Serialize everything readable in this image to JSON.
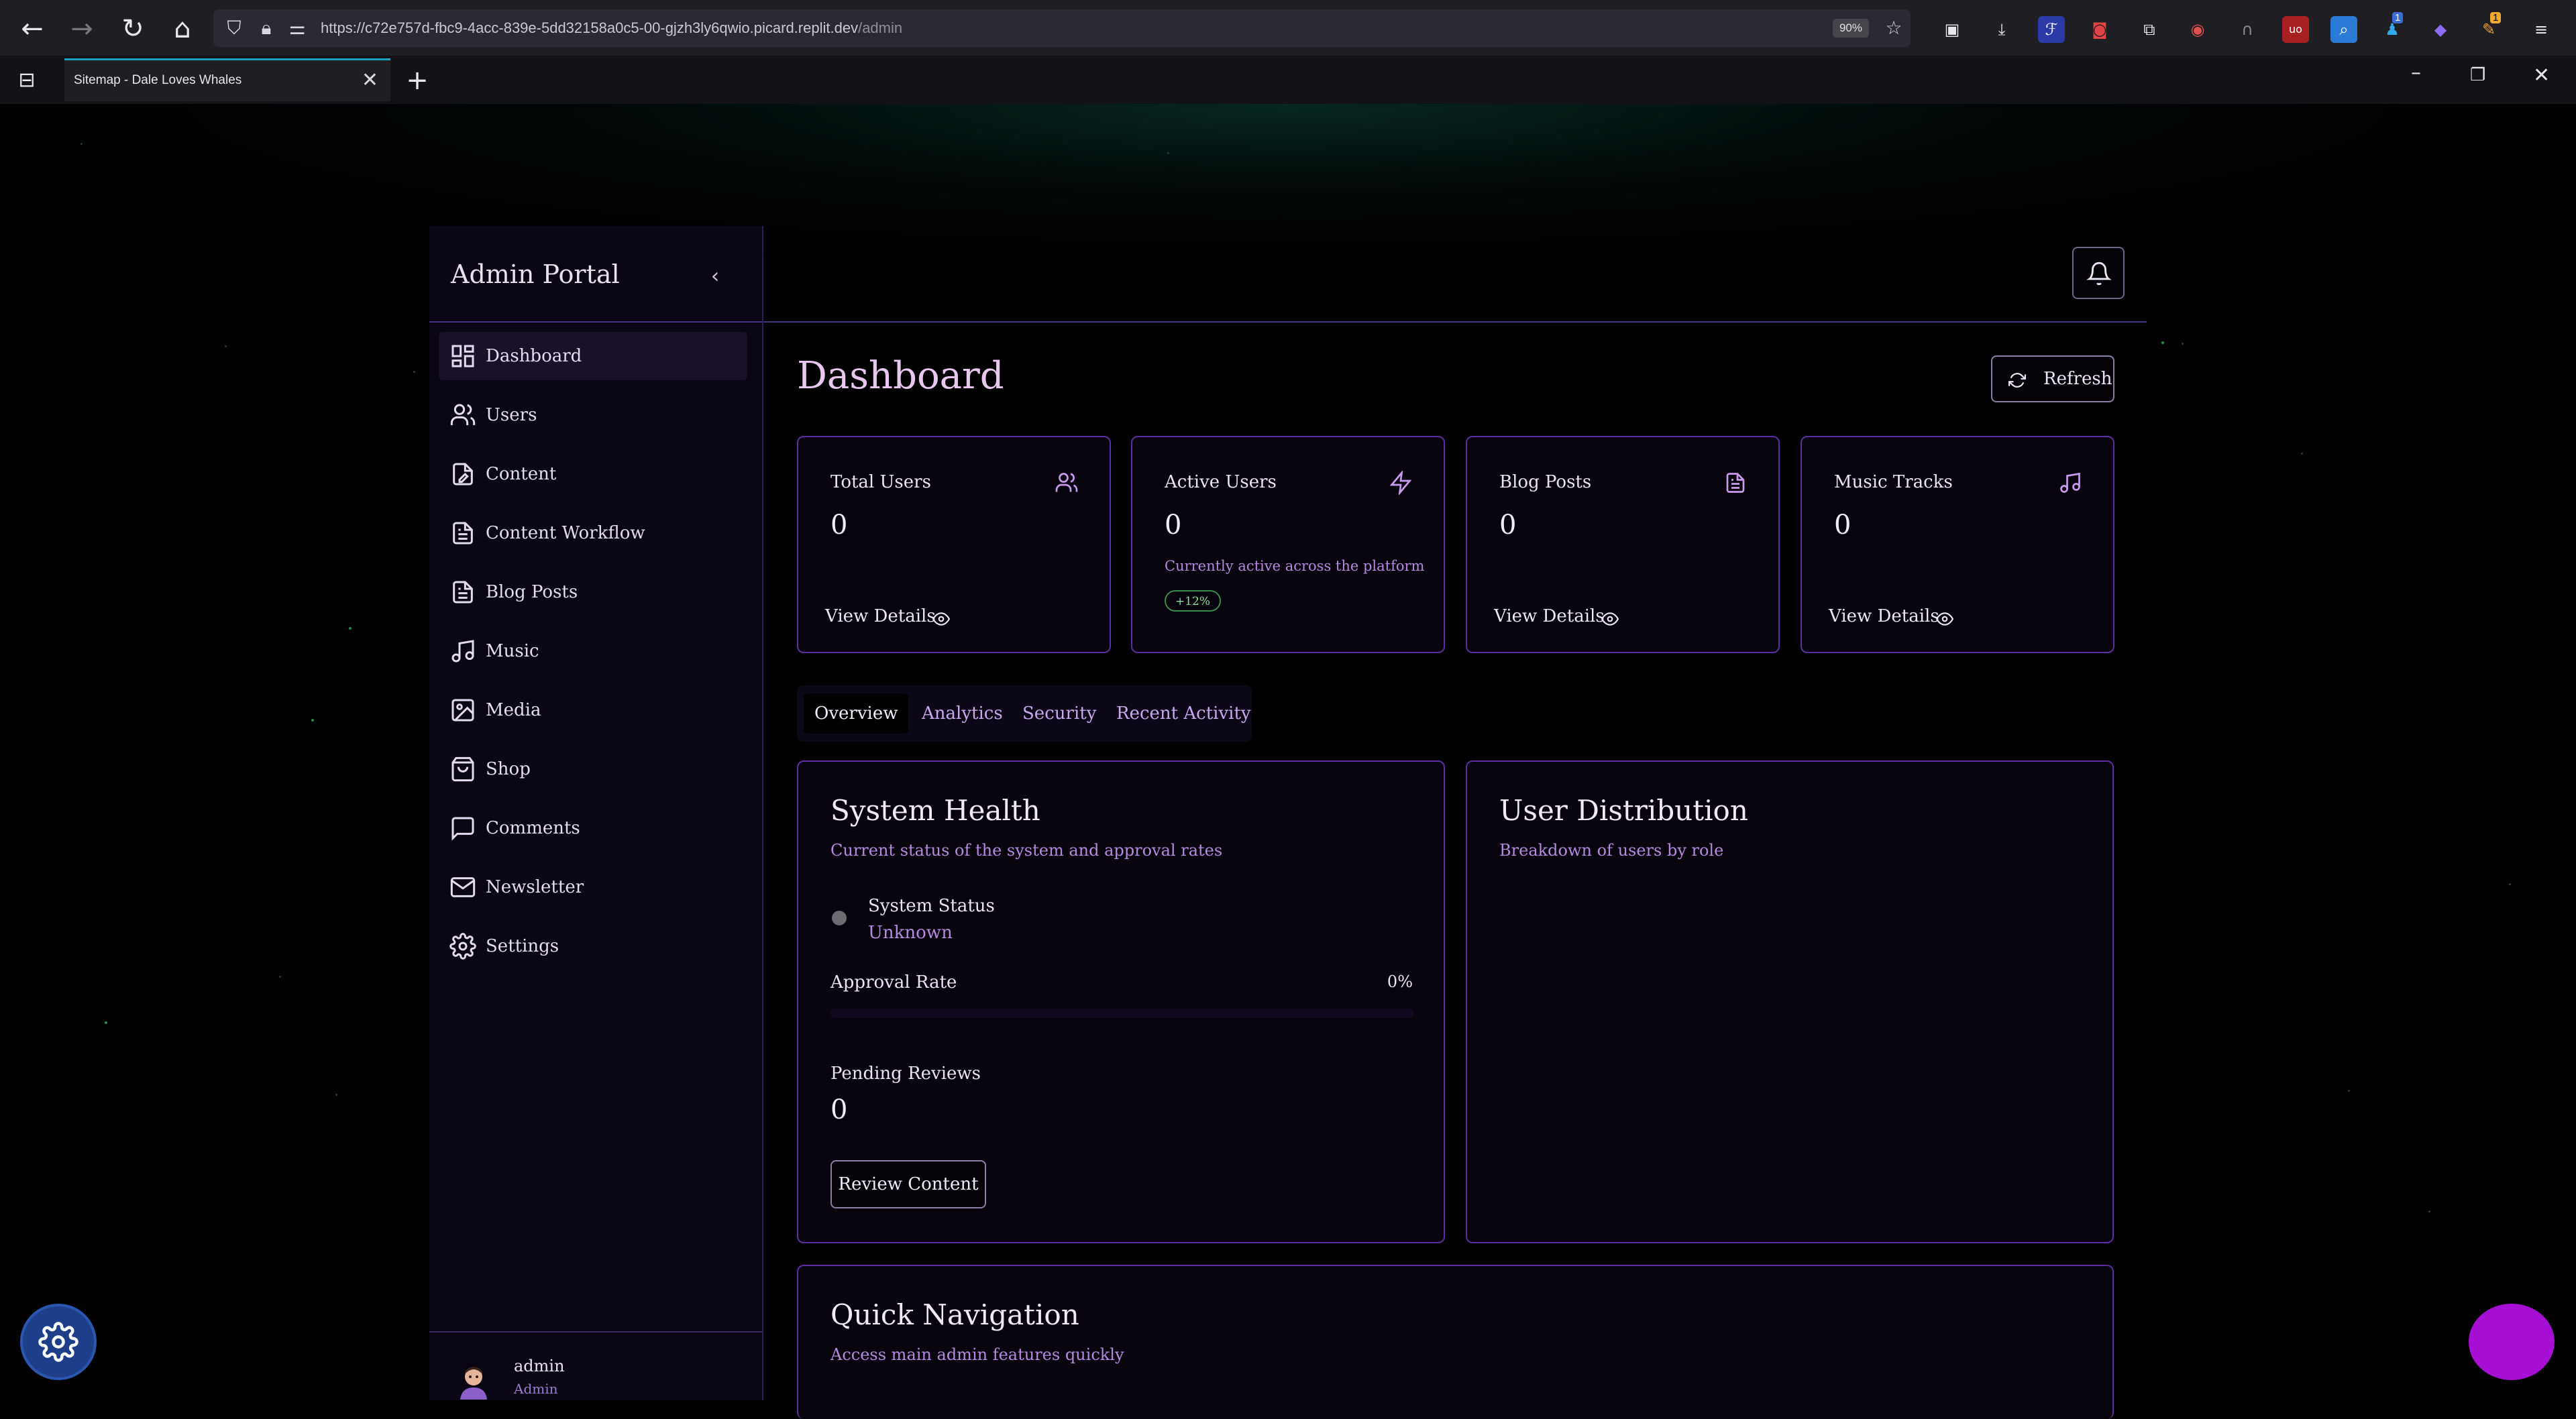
{
  "browser": {
    "url_host": "https://c72e757d-fbc9-4acc-839e-5dd32158a0c5-00-gjzh3ly6qwio.picard.replit.dev",
    "url_path": "/admin",
    "zoom": "90%",
    "tab_title": "Sitemap - Dale Loves Whales",
    "ext_badge_1": "1",
    "ext_badge_2": "1"
  },
  "sidebar": {
    "title": "Admin Portal",
    "items": [
      {
        "label": "Dashboard",
        "icon": "dashboard-icon"
      },
      {
        "label": "Users",
        "icon": "users-icon"
      },
      {
        "label": "Content",
        "icon": "content-icon"
      },
      {
        "label": "Content Workflow",
        "icon": "file-text-icon"
      },
      {
        "label": "Blog Posts",
        "icon": "file-text-icon"
      },
      {
        "label": "Music",
        "icon": "music-icon"
      },
      {
        "label": "Media",
        "icon": "image-icon"
      },
      {
        "label": "Shop",
        "icon": "shop-icon"
      },
      {
        "label": "Comments",
        "icon": "comment-icon"
      },
      {
        "label": "Newsletter",
        "icon": "mail-icon"
      },
      {
        "label": "Settings",
        "icon": "gear-icon"
      }
    ],
    "active_index": 0,
    "user": {
      "name": "admin",
      "role": "Admin"
    }
  },
  "main": {
    "title": "Dashboard",
    "refresh_label": "Refresh",
    "stats": [
      {
        "title": "Total Users",
        "value": "0",
        "link": "View Details",
        "icon": "users-icon"
      },
      {
        "title": "Active Users",
        "value": "0",
        "subtitle": "Currently active across the platform",
        "badge": "+12%",
        "icon": "bolt-icon"
      },
      {
        "title": "Blog Posts",
        "value": "0",
        "link": "View Details",
        "icon": "file-text-icon"
      },
      {
        "title": "Music Tracks",
        "value": "0",
        "link": "View Details",
        "icon": "music-icon"
      }
    ],
    "tabs": [
      "Overview",
      "Analytics",
      "Security",
      "Recent Activity"
    ],
    "active_tab": "Overview",
    "system_health": {
      "title": "System Health",
      "description": "Current status of the system and approval rates",
      "status_label": "System Status",
      "status_value": "Unknown",
      "approval_label": "Approval Rate",
      "approval_value": "0%",
      "approval_fraction": 0,
      "pending_label": "Pending Reviews",
      "pending_value": "0",
      "review_button": "Review Content"
    },
    "user_distribution": {
      "title": "User Distribution",
      "description": "Breakdown of users by role"
    },
    "quick_nav": {
      "title": "Quick Navigation",
      "description": "Access main admin features quickly"
    }
  },
  "colors": {
    "accent": "#5b2fa0",
    "text_accent": "#b58ae0",
    "fab_purple": "#a70fd4",
    "fab_blue": "#1d3f8a"
  }
}
